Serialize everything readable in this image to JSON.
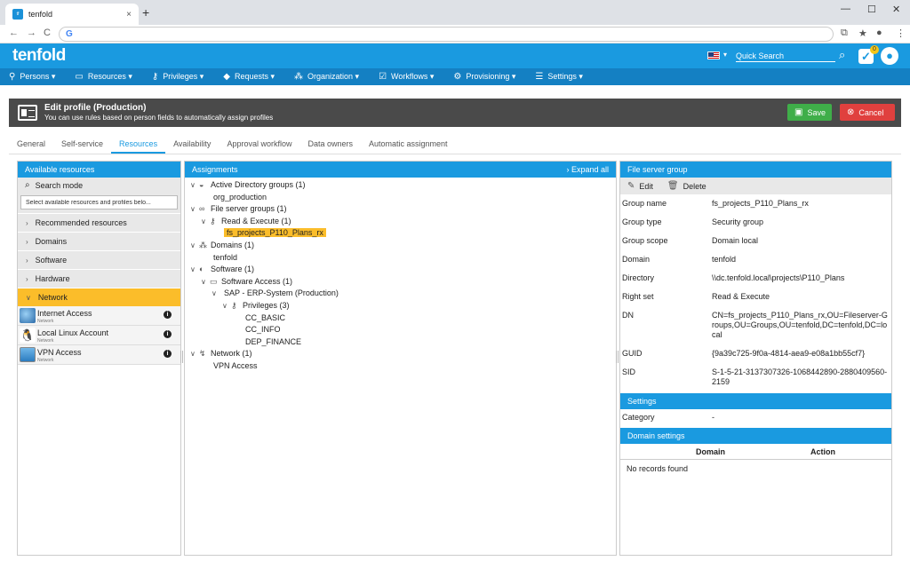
{
  "browser": {
    "tab_title": "tenfold",
    "tab_close": "×",
    "new_tab": "+",
    "window_controls": [
      "—",
      "☐",
      "✕"
    ],
    "nav": [
      "←",
      "→",
      "C"
    ],
    "omnibox_icon": "G",
    "extras": [
      "⧉",
      "★",
      "●",
      "⋮"
    ]
  },
  "app": {
    "logo": "tenfold",
    "quick_search_placeholder": "Quick Search",
    "task_count": "0"
  },
  "menu": [
    {
      "icon": "person-icon",
      "label": "Persons ▾"
    },
    {
      "icon": "monitor-icon",
      "label": "Resources ▾"
    },
    {
      "icon": "key-icon",
      "label": "Privileges ▾"
    },
    {
      "icon": "tag-icon",
      "label": "Requests ▾"
    },
    {
      "icon": "org-chart-icon",
      "label": "Organization ▾"
    },
    {
      "icon": "check-box-icon",
      "label": "Workflows ▾"
    },
    {
      "icon": "gears-icon",
      "label": "Provisioning ▾"
    },
    {
      "icon": "sliders-icon",
      "label": "Settings ▾"
    }
  ],
  "page": {
    "title": "Edit profile (Production)",
    "subtitle": "You can use rules based on person fields to automatically assign profiles",
    "save": "Save",
    "cancel": "Cancel"
  },
  "tabs": [
    "General",
    "Self-service",
    "Resources",
    "Availability",
    "Approval workflow",
    "Data owners",
    "Automatic assignment"
  ],
  "active_tab": "Resources",
  "left": {
    "header": "Available resources",
    "search_mode": "Search mode",
    "search_placeholder": "Select available resources and profiles belo...",
    "categories": [
      "Recommended resources",
      "Domains",
      "Software",
      "Hardware",
      "Network"
    ],
    "resources": [
      {
        "name": "Internet Access",
        "sub": "Network",
        "icon": "globe-icon"
      },
      {
        "name": "Local Linux Account",
        "sub": "Network",
        "icon": "penguin-icon"
      },
      {
        "name": "VPN Access",
        "sub": "Network",
        "icon": "vpn-icon"
      }
    ]
  },
  "middle": {
    "header": "Assignments",
    "expand_all": "› Expand all",
    "tree": [
      {
        "label": "Active Directory groups (1)",
        "level": 0,
        "toggle": "∨",
        "icon": "◒"
      },
      {
        "label": "org_production",
        "level": 1,
        "toggle": "",
        "icon": ""
      },
      {
        "label": "File server groups (1)",
        "level": 0,
        "toggle": "∨",
        "icon": "∞"
      },
      {
        "label": "Read & Execute (1)",
        "level": 1,
        "toggle": "∨",
        "icon": "⚷"
      },
      {
        "label": "fs_projects_P110_Plans_rx",
        "level": 2,
        "toggle": "",
        "icon": "",
        "highlight": true
      },
      {
        "label": "Domains (1)",
        "level": 0,
        "toggle": "∨",
        "icon": "⁂"
      },
      {
        "label": "tenfold",
        "level": 1,
        "toggle": "",
        "icon": ""
      },
      {
        "label": "Software (1)",
        "level": 0,
        "toggle": "∨",
        "icon": "◐"
      },
      {
        "label": "Software Access (1)",
        "level": 1,
        "toggle": "∨",
        "icon": "▭"
      },
      {
        "label": "SAP - ERP-System (Production)",
        "level": 2,
        "toggle": "∨",
        "icon": ""
      },
      {
        "label": "Privileges (3)",
        "level": 3,
        "toggle": "∨",
        "icon": "⚷"
      },
      {
        "label": "CC_BASIC",
        "level": 4,
        "toggle": "",
        "icon": ""
      },
      {
        "label": "CC_INFO",
        "level": 4,
        "toggle": "",
        "icon": ""
      },
      {
        "label": "DEP_FINANCE",
        "level": 4,
        "toggle": "",
        "icon": ""
      },
      {
        "label": "Network (1)",
        "level": 0,
        "toggle": "∨",
        "icon": "↯"
      },
      {
        "label": "VPN Access",
        "level": 1,
        "toggle": "",
        "icon": ""
      }
    ]
  },
  "right": {
    "header": "File server group",
    "edit": "Edit",
    "delete": "Delete",
    "fields": [
      {
        "k": "Group name",
        "v": "fs_projects_P110_Plans_rx"
      },
      {
        "k": "Group type",
        "v": "Security group"
      },
      {
        "k": "Group scope",
        "v": "Domain local"
      },
      {
        "k": "Domain",
        "v": "tenfold"
      },
      {
        "k": "Directory",
        "v": "\\\\dc.tenfold.local\\projects\\P110_Plans"
      },
      {
        "k": "Right set",
        "v": "Read & Execute"
      },
      {
        "k": "DN",
        "v": "CN=fs_projects_P110_Plans_rx,OU=Fileserver-Groups,OU=Groups,OU=tenfold,DC=tenfold,DC=local"
      },
      {
        "k": "GUID",
        "v": "{9a39c725-9f0a-4814-aea9-e08a1bb55cf7}"
      },
      {
        "k": "SID",
        "v": "S-1-5-21-3137307326-1068442890-2880409560-2159"
      }
    ],
    "settings_header": "Settings",
    "category_label": "Category",
    "category_value": "-",
    "domain_settings_header": "Domain settings",
    "col_domain": "Domain",
    "col_action": "Action",
    "no_records": "No records found"
  },
  "colors": {
    "brand": "#1a9ae0",
    "menu": "#1480c3",
    "highlight": "#fbbd2a",
    "save": "#3fae49",
    "cancel": "#e0403e"
  }
}
